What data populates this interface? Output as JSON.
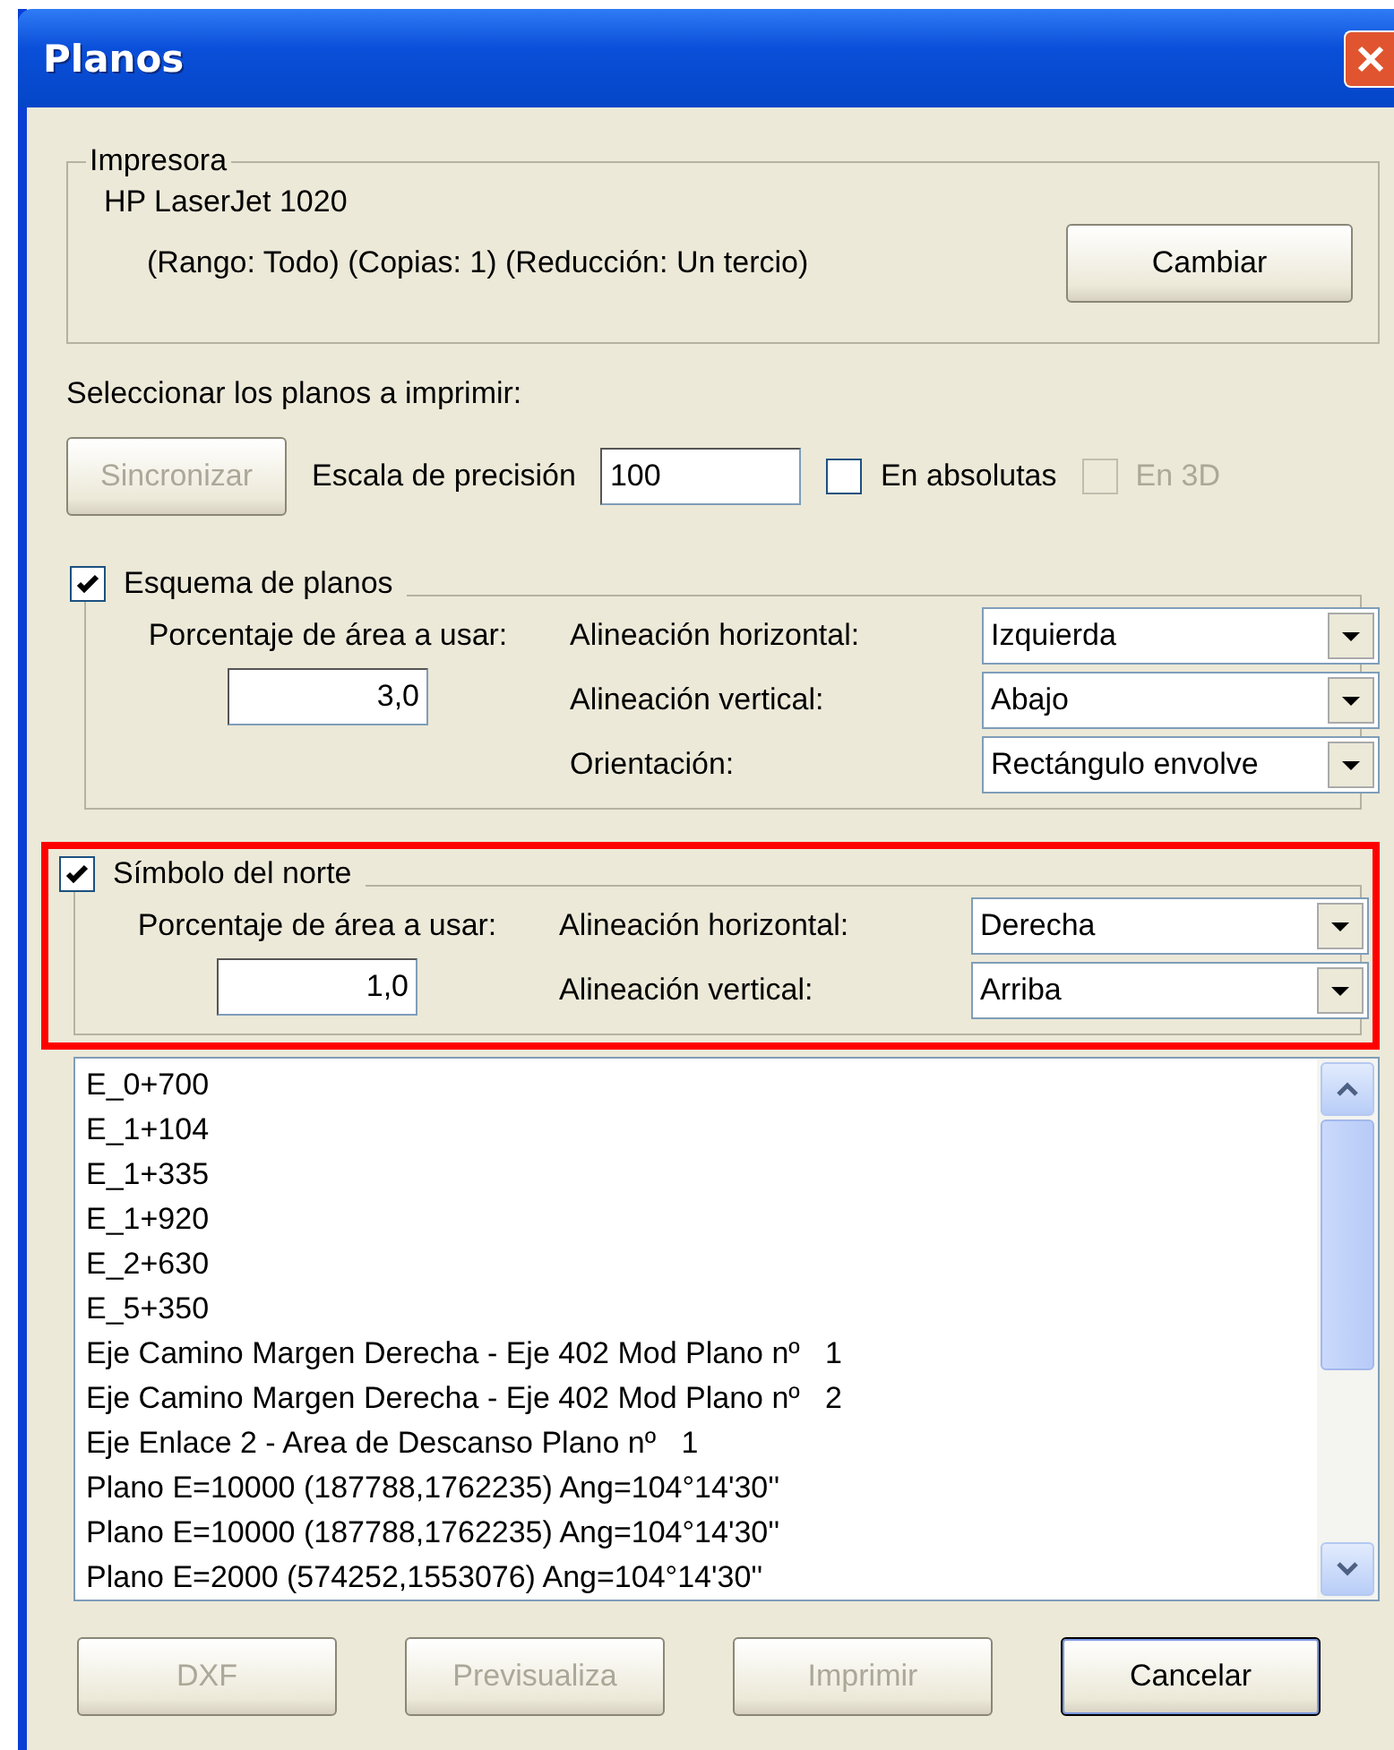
{
  "window": {
    "title": "Planos"
  },
  "printer": {
    "label": "Impresora",
    "name": "HP LaserJet 1020",
    "details": "(Rango: Todo) (Copias: 1) (Reducción: Un tercio)",
    "button": "Cambiar"
  },
  "select_label": "Seleccionar los planos a imprimir:",
  "sync_button": {
    "label": "Sincronizar",
    "disabled": true
  },
  "precision": {
    "label": "Escala de precisión",
    "value": "100"
  },
  "options": [
    {
      "label": "En absolutas",
      "checked": false,
      "disabled": false
    },
    {
      "label": "En 3D",
      "checked": false,
      "disabled": true
    }
  ],
  "sections": [
    {
      "label": "Esquema de planos",
      "checked": true,
      "highlighted": false,
      "percent_label": "Porcentaje de área a usar:",
      "percent_value": "3,0",
      "fields": [
        {
          "label": "Alineación horizontal:",
          "value": "Izquierda"
        },
        {
          "label": "Alineación vertical:",
          "value": "Abajo"
        },
        {
          "label": "Orientación:",
          "value": "Rectángulo envolve"
        }
      ]
    },
    {
      "label": "Símbolo del norte",
      "checked": true,
      "highlighted": true,
      "percent_label": "Porcentaje de área a usar:",
      "percent_value": "1,0",
      "fields": [
        {
          "label": "Alineación horizontal:",
          "value": "Derecha"
        },
        {
          "label": "Alineación vertical:",
          "value": "Arriba"
        }
      ]
    }
  ],
  "list": {
    "items": [
      "E_0+700",
      "E_1+104",
      "E_1+335",
      "E_1+920",
      "E_2+630",
      "E_5+350",
      "Eje Camino Margen Derecha - Eje 402 Mod Plano nº   1",
      "Eje Camino Margen Derecha - Eje 402 Mod Plano nº   2",
      "Eje Enlace 2 - Area de Descanso Plano nº   1",
      "Plano E=10000 (187788,1762235) Ang=104°14'30''",
      "Plano E=10000 (187788,1762235) Ang=104°14'30''",
      "Plano E=2000 (574252,1553076) Ang=104°14'30''"
    ]
  },
  "buttons": [
    {
      "label": "DXF",
      "disabled": true,
      "default": false
    },
    {
      "label": "Previsualiza",
      "disabled": true,
      "default": false
    },
    {
      "label": "Imprimir",
      "disabled": true,
      "default": false
    },
    {
      "label": "Cancelar",
      "disabled": false,
      "default": true
    }
  ]
}
